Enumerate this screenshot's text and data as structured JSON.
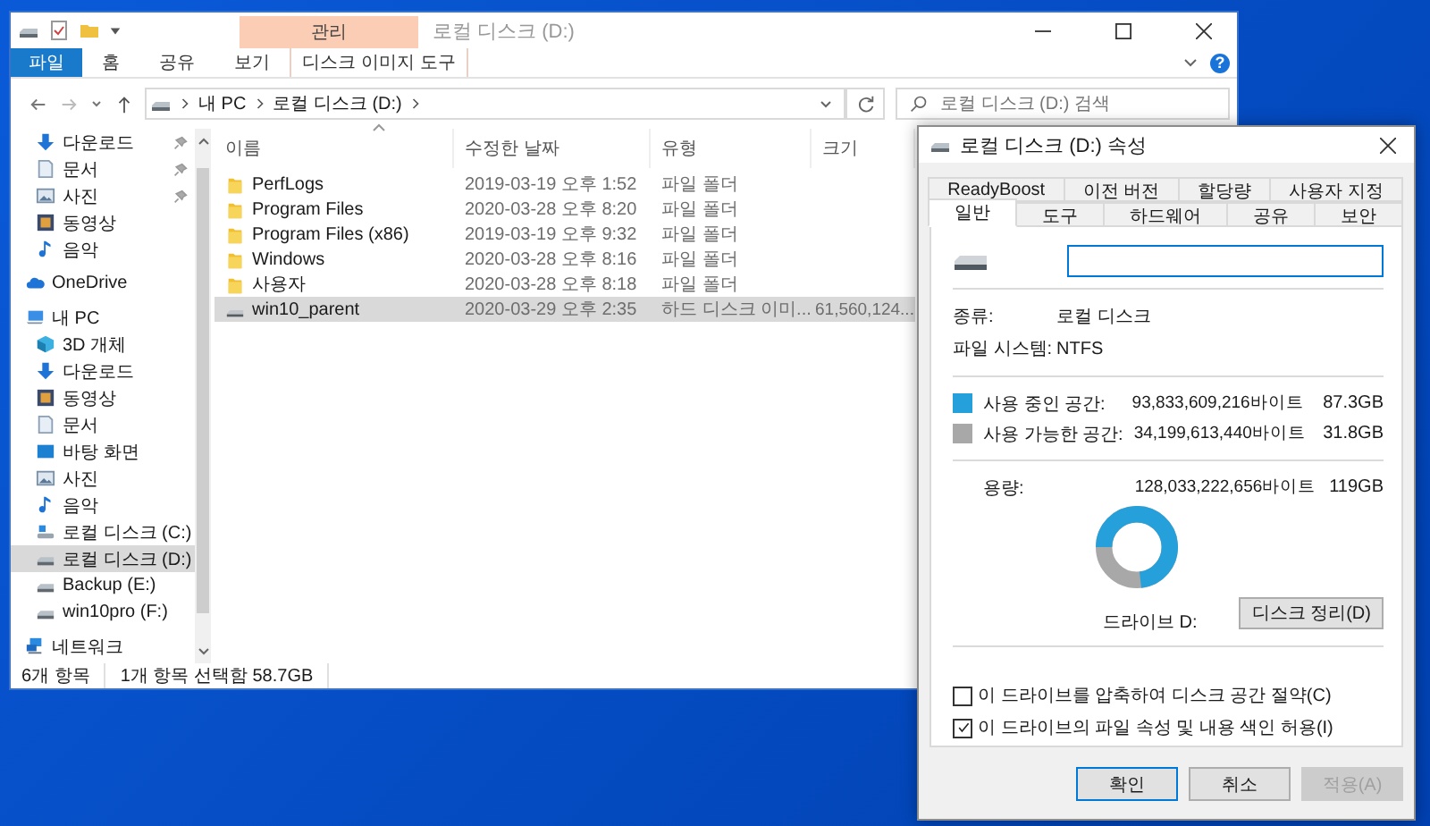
{
  "explorer": {
    "title": "로컬 디스크 (D:)",
    "context_group": "관리",
    "ribbon_tabs": [
      {
        "label": "파일",
        "kind": "file"
      },
      {
        "label": "홈",
        "kind": "normal"
      },
      {
        "label": "공유",
        "kind": "normal"
      },
      {
        "label": "보기",
        "kind": "normal"
      },
      {
        "label": "디스크 이미지 도구",
        "kind": "contextual"
      }
    ],
    "help": "?",
    "address": {
      "segments": [
        "내 PC",
        "로컬 디스크 (D:)"
      ]
    },
    "search": {
      "placeholder": "로컬 디스크 (D:) 검색"
    },
    "quick_access": [
      {
        "label": "다운로드",
        "kind": "download",
        "pinned": true
      },
      {
        "label": "문서",
        "kind": "document",
        "pinned": true
      },
      {
        "label": "사진",
        "kind": "picture",
        "pinned": true
      },
      {
        "label": "동영상",
        "kind": "video",
        "pinned": false
      },
      {
        "label": "음악",
        "kind": "music",
        "pinned": false
      }
    ],
    "nav_tree": [
      {
        "label": "OneDrive",
        "kind": "cloud",
        "selected": false
      },
      {
        "label": "내 PC",
        "kind": "pc",
        "selected": false,
        "children": [
          {
            "label": "3D 개체",
            "kind": "cube",
            "selected": false
          },
          {
            "label": "다운로드",
            "kind": "download",
            "selected": false
          },
          {
            "label": "동영상",
            "kind": "video",
            "selected": false
          },
          {
            "label": "문서",
            "kind": "document",
            "selected": false
          },
          {
            "label": "바탕 화면",
            "kind": "desktop",
            "selected": false
          },
          {
            "label": "사진",
            "kind": "picture",
            "selected": false
          },
          {
            "label": "음악",
            "kind": "music",
            "selected": false
          },
          {
            "label": "로컬 디스크 (C:)",
            "kind": "windrive",
            "selected": false
          },
          {
            "label": "로컬 디스크 (D:)",
            "kind": "drive",
            "selected": true
          },
          {
            "label": "Backup (E:)",
            "kind": "drive",
            "selected": false
          },
          {
            "label": "win10pro (F:)",
            "kind": "drive",
            "selected": false
          }
        ]
      },
      {
        "label": "네트워크",
        "kind": "network",
        "selected": false
      }
    ],
    "columns": [
      "이름",
      "수정한 날짜",
      "유형",
      "크기"
    ],
    "rows": [
      {
        "kind": "folder",
        "name": "PerfLogs",
        "date": "2019-03-19 오후 1:52",
        "type": "파일 폴더",
        "size": "",
        "selected": false
      },
      {
        "kind": "folder",
        "name": "Program Files",
        "date": "2020-03-28 오후 8:20",
        "type": "파일 폴더",
        "size": "",
        "selected": false
      },
      {
        "kind": "folder",
        "name": "Program Files (x86)",
        "date": "2019-03-19 오후 9:32",
        "type": "파일 폴더",
        "size": "",
        "selected": false
      },
      {
        "kind": "folder",
        "name": "Windows",
        "date": "2020-03-28 오후 8:16",
        "type": "파일 폴더",
        "size": "",
        "selected": false
      },
      {
        "kind": "folder",
        "name": "사용자",
        "date": "2020-03-28 오후 8:18",
        "type": "파일 폴더",
        "size": "",
        "selected": false
      },
      {
        "kind": "disk-image",
        "name": "win10_parent",
        "date": "2020-03-29 오후 2:35",
        "type": "하드 디스크 이미...",
        "size": "61,560,124...",
        "selected": true
      }
    ],
    "status_bar": [
      "6개 항목",
      "1개 항목 선택함 58.7GB"
    ]
  },
  "properties": {
    "title": "로컬 디스크 (D:) 속성",
    "tab_rows": [
      [
        {
          "label": "ReadyBoost",
          "selected": false
        },
        {
          "label": "이전 버전",
          "selected": false
        },
        {
          "label": "할당량",
          "selected": false
        },
        {
          "label": "사용자 지정",
          "selected": false
        }
      ],
      [
        {
          "label": "일반",
          "selected": true
        },
        {
          "label": "도구",
          "selected": false
        },
        {
          "label": "하드웨어",
          "selected": false
        },
        {
          "label": "공유",
          "selected": false
        },
        {
          "label": "보안",
          "selected": false
        }
      ]
    ],
    "info": [
      {
        "label": "종류:",
        "value": "로컬 디스크"
      },
      {
        "label": "파일 시스템:",
        "value": "NTFS"
      }
    ],
    "space": [
      {
        "label": "사용 중인 공간:",
        "bytes": "93,833,609,216바이트",
        "size": "87.3GB",
        "color": "#26a0da"
      },
      {
        "label": "사용 가능한 공간:",
        "bytes": "34,199,613,440바이트",
        "size": "31.8GB",
        "color": "#a8a8a8"
      }
    ],
    "capacity": {
      "label": "용량:",
      "bytes": "128,033,222,656바이트",
      "size": "119GB"
    },
    "donut": {
      "caption": "드라이브 D:"
    },
    "cleanup_button": "디스크 정리(D)",
    "options": [
      {
        "label": "이 드라이브를 압축하여 디스크 공간 절약(C)",
        "checked": false
      },
      {
        "label": "이 드라이브의 파일 속성 및 내용 색인 허용(I)",
        "checked": true
      }
    ],
    "buttons": [
      {
        "label": "확인",
        "kind": "default",
        "disabled": false
      },
      {
        "label": "취소",
        "kind": "normal",
        "disabled": false
      },
      {
        "label": "적용(A)",
        "kind": "normal",
        "disabled": true
      }
    ]
  }
}
